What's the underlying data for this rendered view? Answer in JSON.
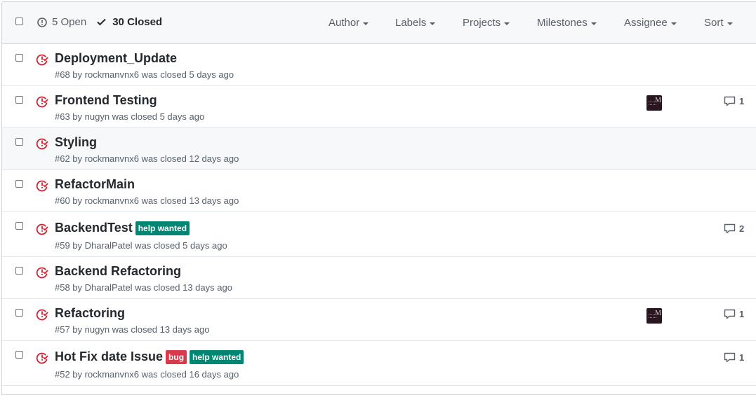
{
  "header": {
    "open_label": "5 Open",
    "closed_label": "30 Closed",
    "filters": [
      "Author",
      "Labels",
      "Projects",
      "Milestones",
      "Assignee",
      "Sort"
    ]
  },
  "colors": {
    "closed_icon": "#cb2431",
    "help_wanted": "#008672",
    "bug": "#d73a4a"
  },
  "issues": [
    {
      "title": "Deployment_Update",
      "meta": "#68 by rockmanvnx6 was closed 5 days ago",
      "labels": [],
      "avatar": false,
      "comments": ""
    },
    {
      "title": "Frontend Testing",
      "meta": "#63 by nugyn was closed 5 days ago",
      "labels": [],
      "avatar": true,
      "comments": "1"
    },
    {
      "title": "Styling",
      "meta": "#62 by rockmanvnx6 was closed 12 days ago",
      "labels": [],
      "avatar": false,
      "comments": ""
    },
    {
      "title": "RefactorMain",
      "meta": "#60 by rockmanvnx6 was closed 13 days ago",
      "labels": [],
      "avatar": false,
      "comments": ""
    },
    {
      "title": "BackendTest",
      "meta": "#59 by DharalPatel was closed 5 days ago",
      "labels": [
        {
          "text": "help wanted",
          "color": "#008672"
        }
      ],
      "avatar": false,
      "comments": "2"
    },
    {
      "title": "Backend Refactoring",
      "meta": "#58 by DharalPatel was closed 13 days ago",
      "labels": [],
      "avatar": false,
      "comments": ""
    },
    {
      "title": "Refactoring",
      "meta": "#57 by nugyn was closed 13 days ago",
      "labels": [],
      "avatar": true,
      "comments": "1"
    },
    {
      "title": "Hot Fix date Issue",
      "meta": "#52 by rockmanvnx6 was closed 16 days ago",
      "labels": [
        {
          "text": "bug",
          "color": "#d73a4a"
        },
        {
          "text": "help wanted",
          "color": "#008672"
        }
      ],
      "avatar": false,
      "comments": "1"
    }
  ],
  "icons": {
    "open": "issue-opened-icon",
    "closed": "check-icon",
    "issue_closed": "issue-closed-icon",
    "comment": "comment-icon"
  }
}
